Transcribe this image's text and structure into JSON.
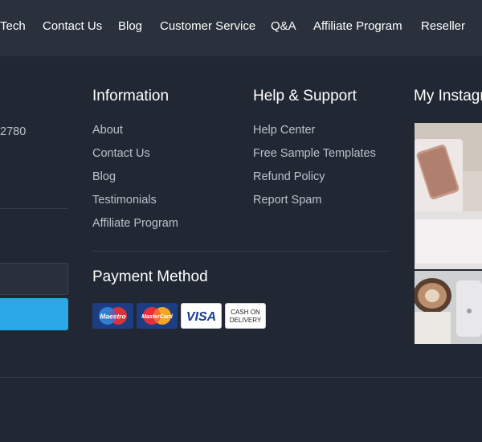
{
  "topnav": {
    "items": [
      "Tech",
      "Contact Us",
      "Blog",
      "Customer Service",
      "Q&A",
      "Affiliate Program",
      "Reseller"
    ]
  },
  "contact": {
    "phone_fragment": "2780"
  },
  "information": {
    "title": "Information",
    "links": [
      "About",
      "Contact Us",
      "Blog",
      "Testimonials",
      "Affiliate Program"
    ]
  },
  "help": {
    "title": "Help & Support",
    "links": [
      "Help Center",
      "Free Sample Templates",
      "Refund Policy",
      "Report Spam"
    ]
  },
  "payment": {
    "title": "Payment Method",
    "cards": [
      {
        "name": "Maestro",
        "label": "Maestro"
      },
      {
        "name": "MasterCard",
        "label": "MasterCard"
      },
      {
        "name": "VISA",
        "label": "VISA"
      },
      {
        "name": "Cash on Delivery",
        "label_line1": "CASH ON",
        "label_line2": "DELIVERY"
      }
    ]
  },
  "instagram": {
    "title": "My Instagram"
  }
}
